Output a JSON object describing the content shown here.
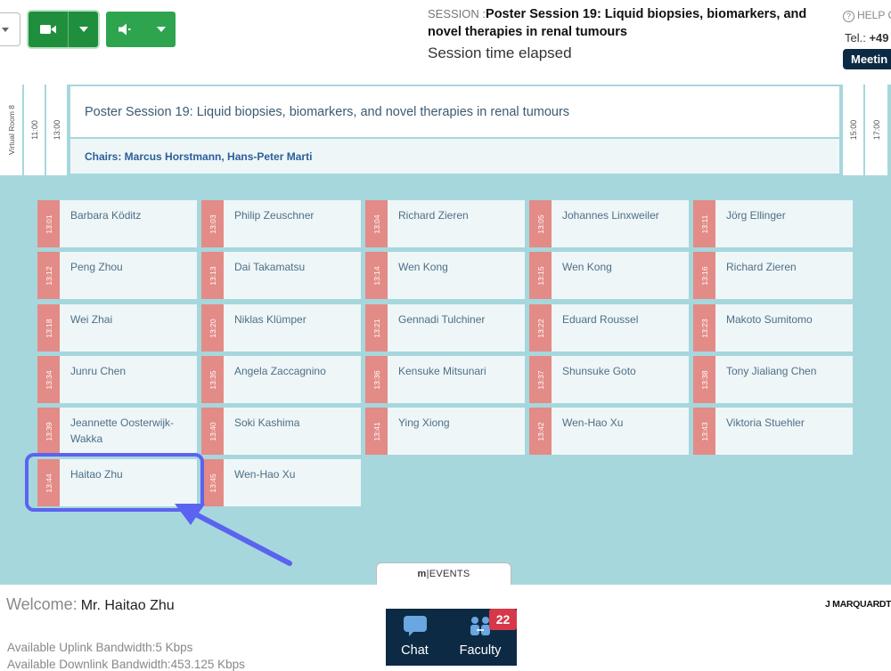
{
  "header": {
    "session_prefix": "SESSION :",
    "session_name": "Poster Session 19: Liquid biopsies, biomarkers, and novel therapies in renal tumours",
    "elapsed_label": "Session time elapsed",
    "help_label": "HELP C",
    "tel_label": "Tel.:",
    "tel_value": "+49",
    "meeting_label": "Meetin"
  },
  "schedule": {
    "room": "Virtual Room 8",
    "left_times": [
      "11:00",
      "13:00"
    ],
    "right_times": [
      "15:00",
      "17:00"
    ],
    "title": "Poster Session 19: Liquid biopsies, biomarkers, and novel therapies in renal tumours",
    "chairs": "Chairs: Marcus Horstmann, Hans-Peter Marti"
  },
  "presentations": [
    {
      "time": "13:01",
      "name": "Barbara Köditz"
    },
    {
      "time": "13:03",
      "name": "Philip Zeuschner"
    },
    {
      "time": "13:04",
      "name": "Richard Zieren"
    },
    {
      "time": "13:05",
      "name": "Johannes Linxweiler"
    },
    {
      "time": "13:11",
      "name": "Jörg Ellinger"
    },
    {
      "time": "13:12",
      "name": "Peng Zhou"
    },
    {
      "time": "13:13",
      "name": "Dai Takamatsu"
    },
    {
      "time": "13:14",
      "name": "Wen Kong"
    },
    {
      "time": "13:15",
      "name": "Wen Kong"
    },
    {
      "time": "13:16",
      "name": "Richard Zieren"
    },
    {
      "time": "13:18",
      "name": "Wei Zhai"
    },
    {
      "time": "13:20",
      "name": "Niklas Klümper"
    },
    {
      "time": "13:21",
      "name": "Gennadi Tulchiner"
    },
    {
      "time": "13:22",
      "name": "Eduard Roussel"
    },
    {
      "time": "13:23",
      "name": "Makoto Sumitomo"
    },
    {
      "time": "13:34",
      "name": "Junru Chen"
    },
    {
      "time": "13:35",
      "name": "Angela Zaccagnino"
    },
    {
      "time": "13:36",
      "name": "Kensuke Mitsunari"
    },
    {
      "time": "13:37",
      "name": "Shunsuke Goto"
    },
    {
      "time": "13:38",
      "name": "Tony Jialiang Chen"
    },
    {
      "time": "13:39",
      "name": "Jeannette Oosterwijk-Wakka"
    },
    {
      "time": "13:40",
      "name": "Soki Kashima"
    },
    {
      "time": "13:41",
      "name": "Ying Xiong"
    },
    {
      "time": "13:42",
      "name": "Wen-Hao Xu"
    },
    {
      "time": "13:43",
      "name": "Viktoria Stuehler"
    },
    {
      "time": "13:44",
      "name": "Haitao Zhu"
    },
    {
      "time": "13:45",
      "name": "Wen-Hao Xu"
    }
  ],
  "footer": {
    "tab_brand_bold": "m",
    "tab_brand_rest": "|EVENTS",
    "welcome_label": "Welcome:",
    "user_name": "Mr. Haitao Zhu",
    "uplink": "Available Uplink Bandwidth:5 Kbps",
    "downlink": "Available Downlink Bandwidth:453.125 Kbps",
    "brand": "J MARQUARDT",
    "chat_label": "Chat",
    "faculty_label": "Faculty",
    "faculty_badge": "22"
  },
  "colors": {
    "teal_bg": "#a6d7dd",
    "time_tab": "#e38b87",
    "card_bg": "#eef6f8",
    "green_button": "#2ea44f",
    "dock_bg": "#0d2a44",
    "highlight": "#5b63f0",
    "badge": "#d6384a"
  },
  "icons": [
    "video-camera-icon",
    "speaker-icon",
    "chat-bubble-icon",
    "faculty-people-icon",
    "help-icon"
  ]
}
